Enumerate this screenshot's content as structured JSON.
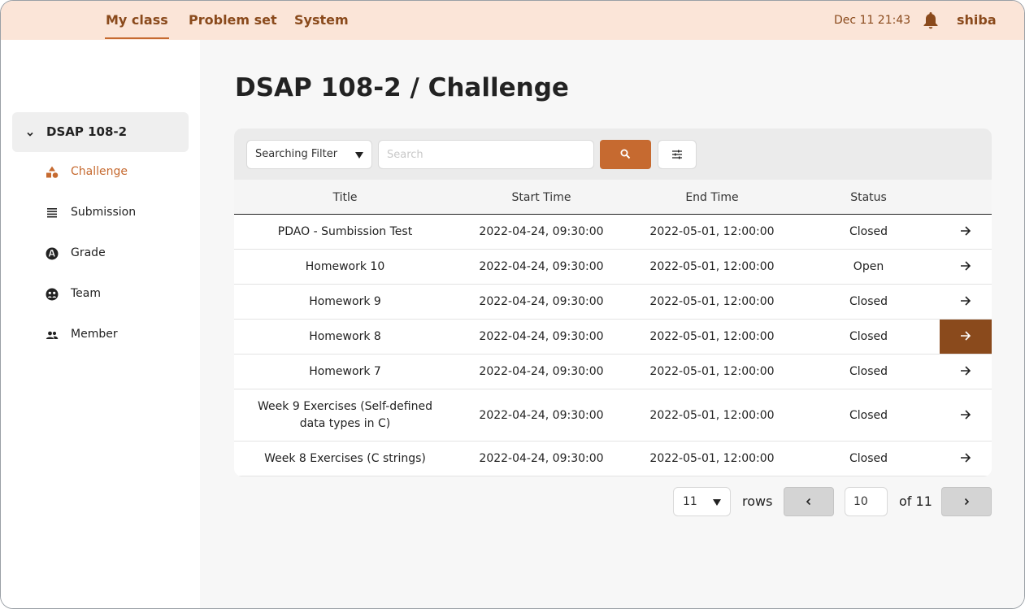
{
  "nav": {
    "items": [
      {
        "label": "My class",
        "active": true
      },
      {
        "label": "Problem set",
        "active": false
      },
      {
        "label": "System",
        "active": false
      }
    ],
    "datetime": "Dec 11  21:43",
    "notification_icon": "bell-icon",
    "username": "shiba"
  },
  "sidebar": {
    "course": "DSAP 108-2",
    "items": [
      {
        "label": "Challenge",
        "icon": "shapes-icon",
        "active": true
      },
      {
        "label": "Submission",
        "icon": "list-icon",
        "active": false
      },
      {
        "label": "Grade",
        "icon": "grade-icon",
        "active": false
      },
      {
        "label": "Team",
        "icon": "team-icon",
        "active": false
      },
      {
        "label": "Member",
        "icon": "people-icon",
        "active": false
      }
    ]
  },
  "main": {
    "title": "DSAP 108-2 / Challenge",
    "filter": {
      "label": "Searching Filter"
    },
    "search": {
      "placeholder": "Search",
      "value": ""
    },
    "table": {
      "columns": [
        "Title",
        "Start Time",
        "End Time",
        "Status"
      ],
      "rows": [
        {
          "title": "PDAO - Sumbission Test",
          "start": "2022-04-24, 09:30:00",
          "end": "2022-05-01, 12:00:00",
          "status": "Closed"
        },
        {
          "title": "Homework 10",
          "start": "2022-04-24, 09:30:00",
          "end": "2022-05-01, 12:00:00",
          "status": "Open"
        },
        {
          "title": "Homework 9",
          "start": "2022-04-24, 09:30:00",
          "end": "2022-05-01, 12:00:00",
          "status": "Closed"
        },
        {
          "title": "Homework 8",
          "start": "2022-04-24, 09:30:00",
          "end": "2022-05-01, 12:00:00",
          "status": "Closed"
        },
        {
          "title": "Homework 7",
          "start": "2022-04-24, 09:30:00",
          "end": "2022-05-01, 12:00:00",
          "status": "Closed"
        },
        {
          "title": "Week 9 Exercises (Self-defined data types in C)",
          "start": "2022-04-24, 09:30:00",
          "end": "2022-05-01, 12:00:00",
          "status": "Closed"
        },
        {
          "title": "Week 8 Exercises (C strings)",
          "start": "2022-04-24, 09:30:00",
          "end": "2022-05-01, 12:00:00",
          "status": "Closed"
        }
      ]
    },
    "pagination": {
      "rows_per_page": "11",
      "rows_label": "rows",
      "current_page": "10",
      "of_label": "of 11"
    }
  },
  "colors": {
    "topbar_bg": "#fbe5d8",
    "brand_text": "#8a4a1c",
    "accent": "#c66a30",
    "hover_arrow": "#8a4a1c"
  }
}
